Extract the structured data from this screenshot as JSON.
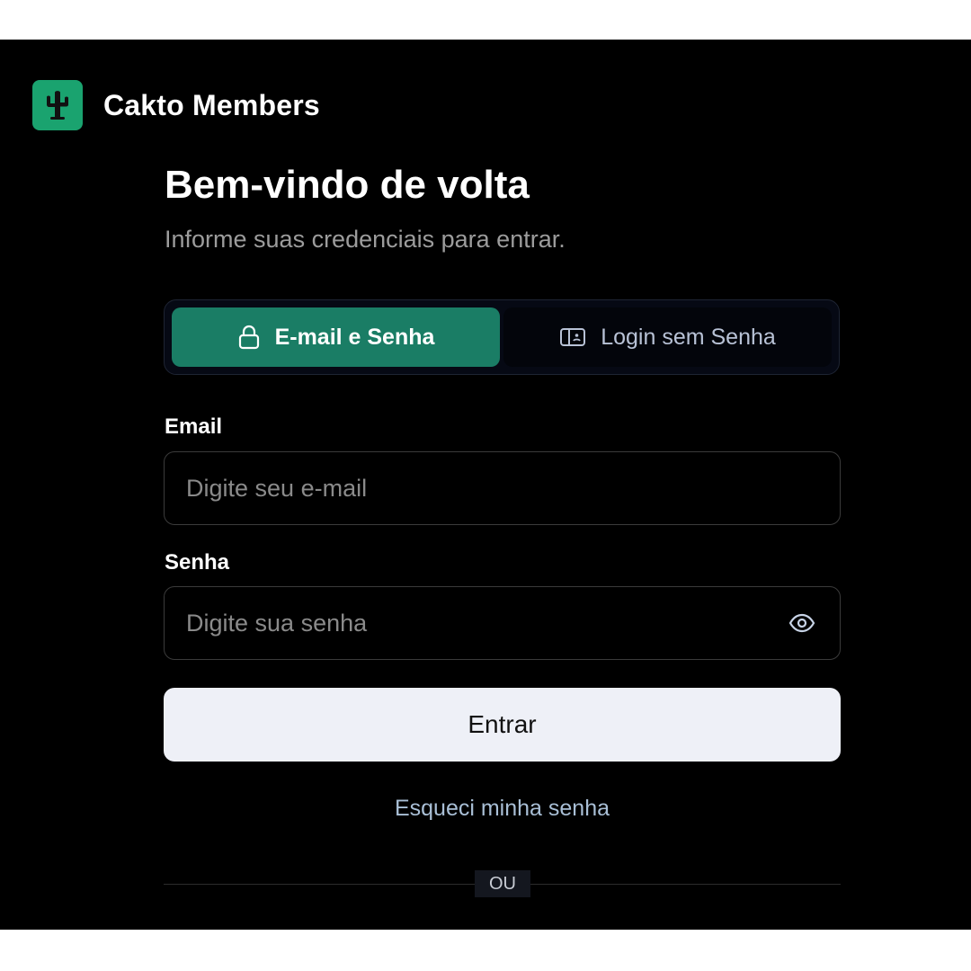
{
  "brand": {
    "name": "Cakto Members",
    "logo_color": "#1aa36f"
  },
  "header": {
    "title": "Bem-vindo de volta",
    "subtitle": "Informe suas credenciais para entrar."
  },
  "tabs": [
    {
      "label": "E-mail e Senha",
      "icon": "lock-icon",
      "active": true
    },
    {
      "label": "Login sem Senha",
      "icon": "magic-link-icon",
      "active": false
    }
  ],
  "form": {
    "email_label": "Email",
    "email_placeholder": "Digite seu e-mail",
    "email_value": "",
    "password_label": "Senha",
    "password_placeholder": "Digite sua senha",
    "password_value": "",
    "password_toggle_icon": "eye-icon",
    "submit_label": "Entrar",
    "forgot_label": "Esqueci minha senha"
  },
  "divider": {
    "label": "OU"
  },
  "colors": {
    "accent": "#1a7d65",
    "background": "#000000",
    "button": "#eef0f7"
  }
}
